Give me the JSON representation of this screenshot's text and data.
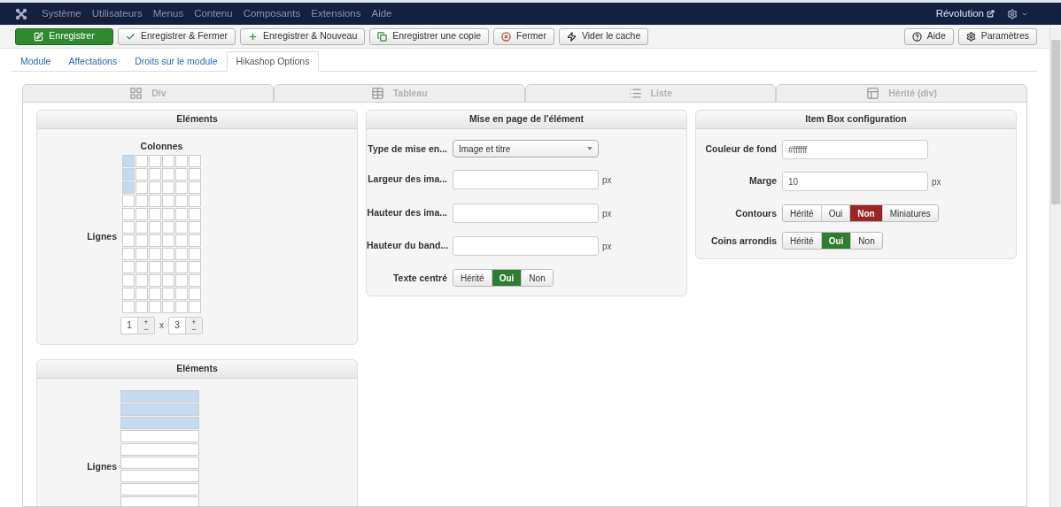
{
  "topbar": {
    "menu": [
      "Système",
      "Utilisateurs",
      "Menus",
      "Contenu",
      "Composants",
      "Extensions",
      "Aide"
    ],
    "site_link": "Révolution"
  },
  "toolbar": {
    "left": [
      "Enregistrer",
      "Enregistrer & Fermer",
      "Enregistrer & Nouveau",
      "Enregistrer une copie",
      "Fermer",
      "Vider le cache"
    ],
    "right": [
      "Aide",
      "Paramètres"
    ]
  },
  "tabs": [
    {
      "label": "Module",
      "selected": false
    },
    {
      "label": "Affectations",
      "selected": false
    },
    {
      "label": "Droits sur le module",
      "selected": false
    },
    {
      "label": "Hikashop Options",
      "selected": true
    }
  ],
  "layout_tabs": [
    {
      "label": "Div",
      "selected": false
    },
    {
      "label": "Tableau",
      "selected": false
    },
    {
      "label": "Liste",
      "selected": false
    },
    {
      "label": "Hérité (div)",
      "selected": false
    }
  ],
  "div_elements": {
    "title": "Eléments",
    "columns_label": "Colonnes",
    "rows_label": "Lignes",
    "grid": [
      [
        {
          "selected": true
        },
        {
          "selected": false
        },
        {
          "selected": false
        },
        {
          "selected": false
        },
        {
          "selected": false
        },
        {
          "selected": false
        }
      ],
      [
        {
          "selected": true
        },
        {
          "selected": false
        },
        {
          "selected": false
        },
        {
          "selected": false
        },
        {
          "selected": false
        },
        {
          "selected": false
        }
      ],
      [
        {
          "selected": true
        },
        {
          "selected": false
        },
        {
          "selected": false
        },
        {
          "selected": false
        },
        {
          "selected": false
        },
        {
          "selected": false
        }
      ],
      [
        {
          "selected": false
        },
        {
          "selected": false
        },
        {
          "selected": false
        },
        {
          "selected": false
        },
        {
          "selected": false
        },
        {
          "selected": false
        }
      ],
      [
        {
          "selected": false
        },
        {
          "selected": false
        },
        {
          "selected": false
        },
        {
          "selected": false
        },
        {
          "selected": false
        },
        {
          "selected": false
        }
      ],
      [
        {
          "selected": false
        },
        {
          "selected": false
        },
        {
          "selected": false
        },
        {
          "selected": false
        },
        {
          "selected": false
        },
        {
          "selected": false
        }
      ],
      [
        {
          "selected": false
        },
        {
          "selected": false
        },
        {
          "selected": false
        },
        {
          "selected": false
        },
        {
          "selected": false
        },
        {
          "selected": false
        }
      ],
      [
        {
          "selected": false
        },
        {
          "selected": false
        },
        {
          "selected": false
        },
        {
          "selected": false
        },
        {
          "selected": false
        },
        {
          "selected": false
        }
      ],
      [
        {
          "selected": false
        },
        {
          "selected": false
        },
        {
          "selected": false
        },
        {
          "selected": false
        },
        {
          "selected": false
        },
        {
          "selected": false
        }
      ],
      [
        {
          "selected": false
        },
        {
          "selected": false
        },
        {
          "selected": false
        },
        {
          "selected": false
        },
        {
          "selected": false
        },
        {
          "selected": false
        }
      ],
      [
        {
          "selected": false
        },
        {
          "selected": false
        },
        {
          "selected": false
        },
        {
          "selected": false
        },
        {
          "selected": false
        },
        {
          "selected": false
        }
      ],
      [
        {
          "selected": false
        },
        {
          "selected": false
        },
        {
          "selected": false
        },
        {
          "selected": false
        },
        {
          "selected": false
        },
        {
          "selected": false
        }
      ]
    ],
    "spinners": [
      {
        "value": "1",
        "up": "+",
        "down": "−"
      },
      {
        "value": "3",
        "up": "+",
        "down": "−"
      }
    ],
    "separator": "x"
  },
  "list_elements": {
    "title": "Eléments",
    "rows_label": "Lignes",
    "rows": [
      {
        "selected": true
      },
      {
        "selected": true
      },
      {
        "selected": true
      },
      {
        "selected": false
      },
      {
        "selected": false
      },
      {
        "selected": false
      },
      {
        "selected": false
      },
      {
        "selected": false
      },
      {
        "selected": false
      }
    ]
  },
  "layout_panel": {
    "title": "Mise en page de l'élément",
    "fields": [
      {
        "kind": "select",
        "label": "Type de mise en...",
        "value": "Image et titre"
      },
      {
        "kind": "input",
        "label": "Largeur des ima...",
        "unit": "px"
      },
      {
        "kind": "input",
        "label": "Hauteur des ima...",
        "unit": "px"
      },
      {
        "kind": "input",
        "label": "Hauteur du band...",
        "unit": "px"
      },
      {
        "kind": "toggle",
        "label": "Texte centré",
        "options": [
          {
            "label": "Hérité",
            "selected": false
          },
          {
            "label": "Oui",
            "selected": true
          },
          {
            "label": "Non",
            "selected": false
          }
        ]
      }
    ]
  },
  "item_box": {
    "title": "Item Box configuration",
    "fields": [
      {
        "kind": "input",
        "label": "Couleur de fond",
        "value": "#ffffff"
      },
      {
        "kind": "input",
        "label": "Marge",
        "value": "10",
        "unit": "px"
      },
      {
        "kind": "toggle",
        "label": "Contours",
        "options": [
          {
            "label": "Hérité",
            "selected": false
          },
          {
            "label": "Oui",
            "selected": false
          },
          {
            "label": "Non",
            "selected": true
          },
          {
            "label": "Miniatures",
            "selected": false
          }
        ]
      },
      {
        "kind": "toggle",
        "label": "Coins arrondis",
        "options": [
          {
            "label": "Hérité",
            "selected": false
          },
          {
            "label": "Oui",
            "selected": true
          },
          {
            "label": "Non",
            "selected": false
          }
        ]
      }
    ]
  }
}
